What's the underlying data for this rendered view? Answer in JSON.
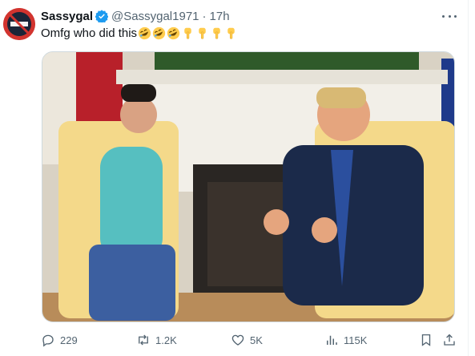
{
  "tweet": {
    "display_name": "Sassygal",
    "handle": "@Sassygal1971",
    "separator": "·",
    "time": "17h",
    "text": "Omfg who did this",
    "emojis": [
      "rolling-on-floor-laughing",
      "rolling-on-floor-laughing",
      "rolling-on-floor-laughing",
      "backhand-index-pointing-down",
      "backhand-index-pointing-down",
      "backhand-index-pointing-down",
      "backhand-index-pointing-down"
    ],
    "media_alt": "photo"
  },
  "actions": {
    "replies": "229",
    "reposts": "1.2K",
    "likes": "5K",
    "views": "115K"
  },
  "icons": [
    "avatar",
    "verified-badge-icon",
    "more-icon",
    "reply-icon",
    "repost-icon",
    "like-icon",
    "views-icon",
    "bookmark-icon",
    "share-icon"
  ],
  "colors": {
    "verified": "#1d9bf0",
    "text": "#0f1419",
    "muted": "#536471"
  }
}
